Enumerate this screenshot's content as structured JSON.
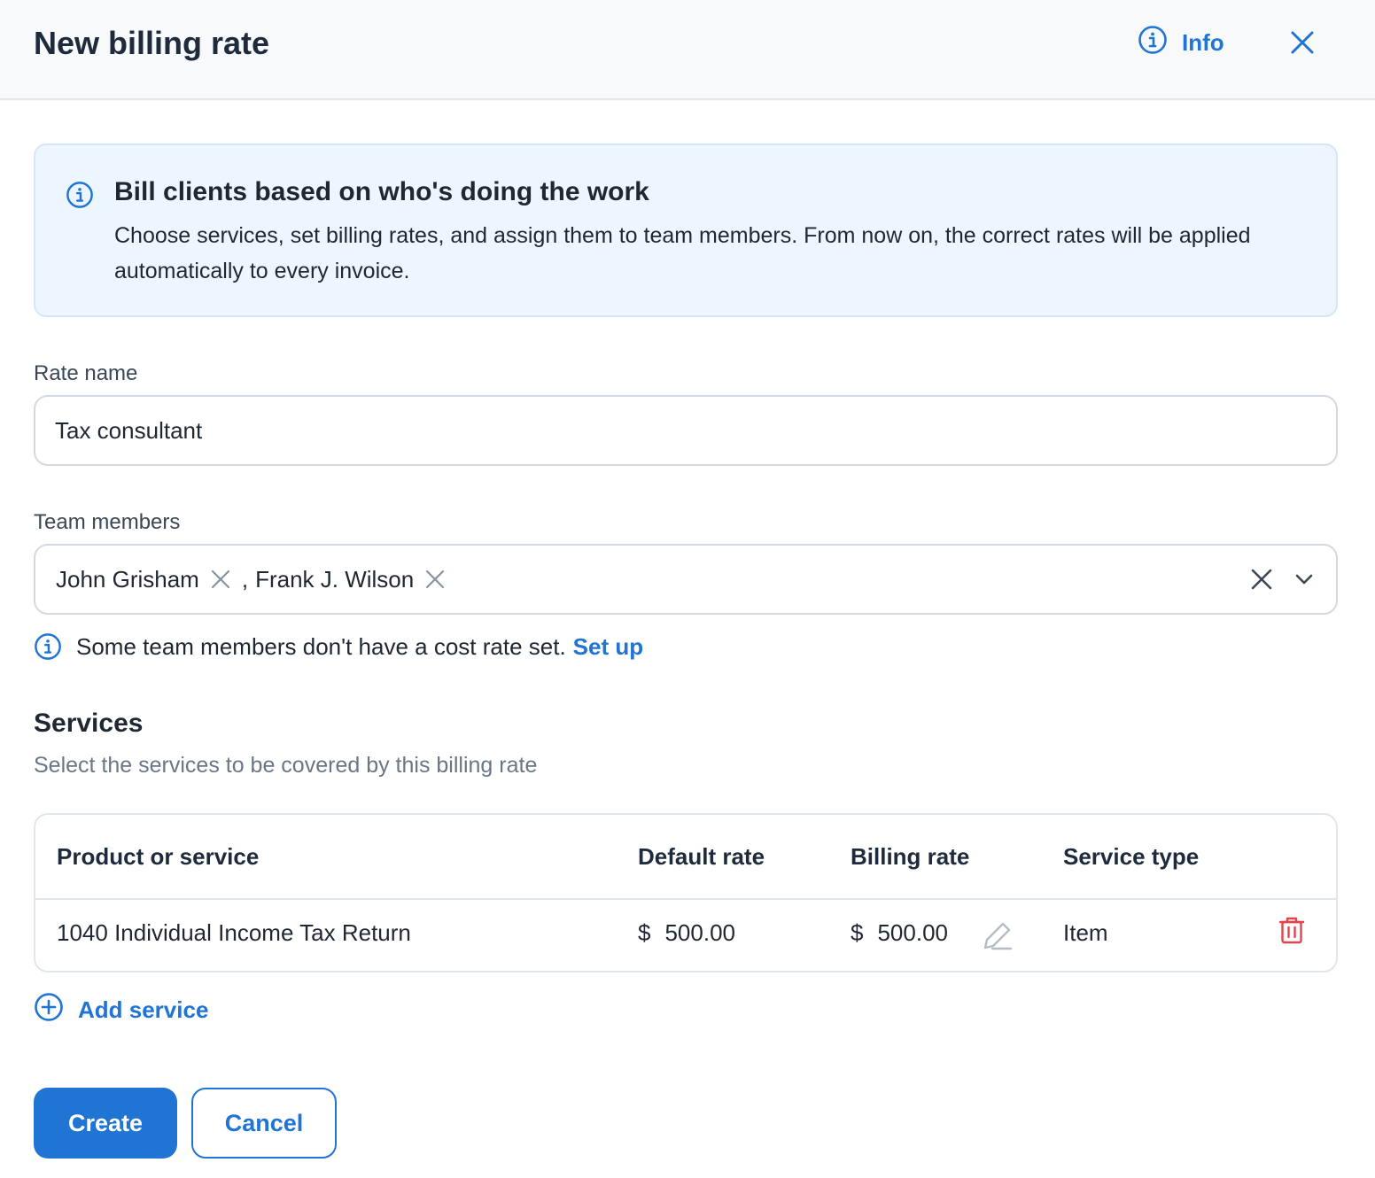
{
  "header": {
    "title": "New billing rate",
    "info_label": "Info"
  },
  "banner": {
    "title": "Bill clients based on who's doing the work",
    "text": "Choose services, set billing rates, and assign them to team members. From now on, the correct rates will be applied automatically to every invoice."
  },
  "rate_name": {
    "label": "Rate name",
    "value": "Tax consultant"
  },
  "team_members": {
    "label": "Team members",
    "selected": [
      "John Grisham",
      "Frank J. Wilson"
    ],
    "separator": ","
  },
  "notice": {
    "text": "Some team members don't have a cost rate set.",
    "link": "Set up"
  },
  "services": {
    "title": "Services",
    "subtitle": "Select the services to be covered by this billing rate",
    "columns": [
      "Product or service",
      "Default rate",
      "Billing rate",
      "Service type"
    ],
    "rows": [
      {
        "name": "1040 Individual Income Tax Return",
        "currency": "$",
        "default_rate": "500.00",
        "billing_rate": "500.00",
        "type": "Item"
      }
    ],
    "add_label": "Add service"
  },
  "actions": {
    "create": "Create",
    "cancel": "Cancel"
  },
  "colors": {
    "accent": "#1f74d4",
    "danger": "#e0454d",
    "banner_bg": "#edf6ff"
  }
}
